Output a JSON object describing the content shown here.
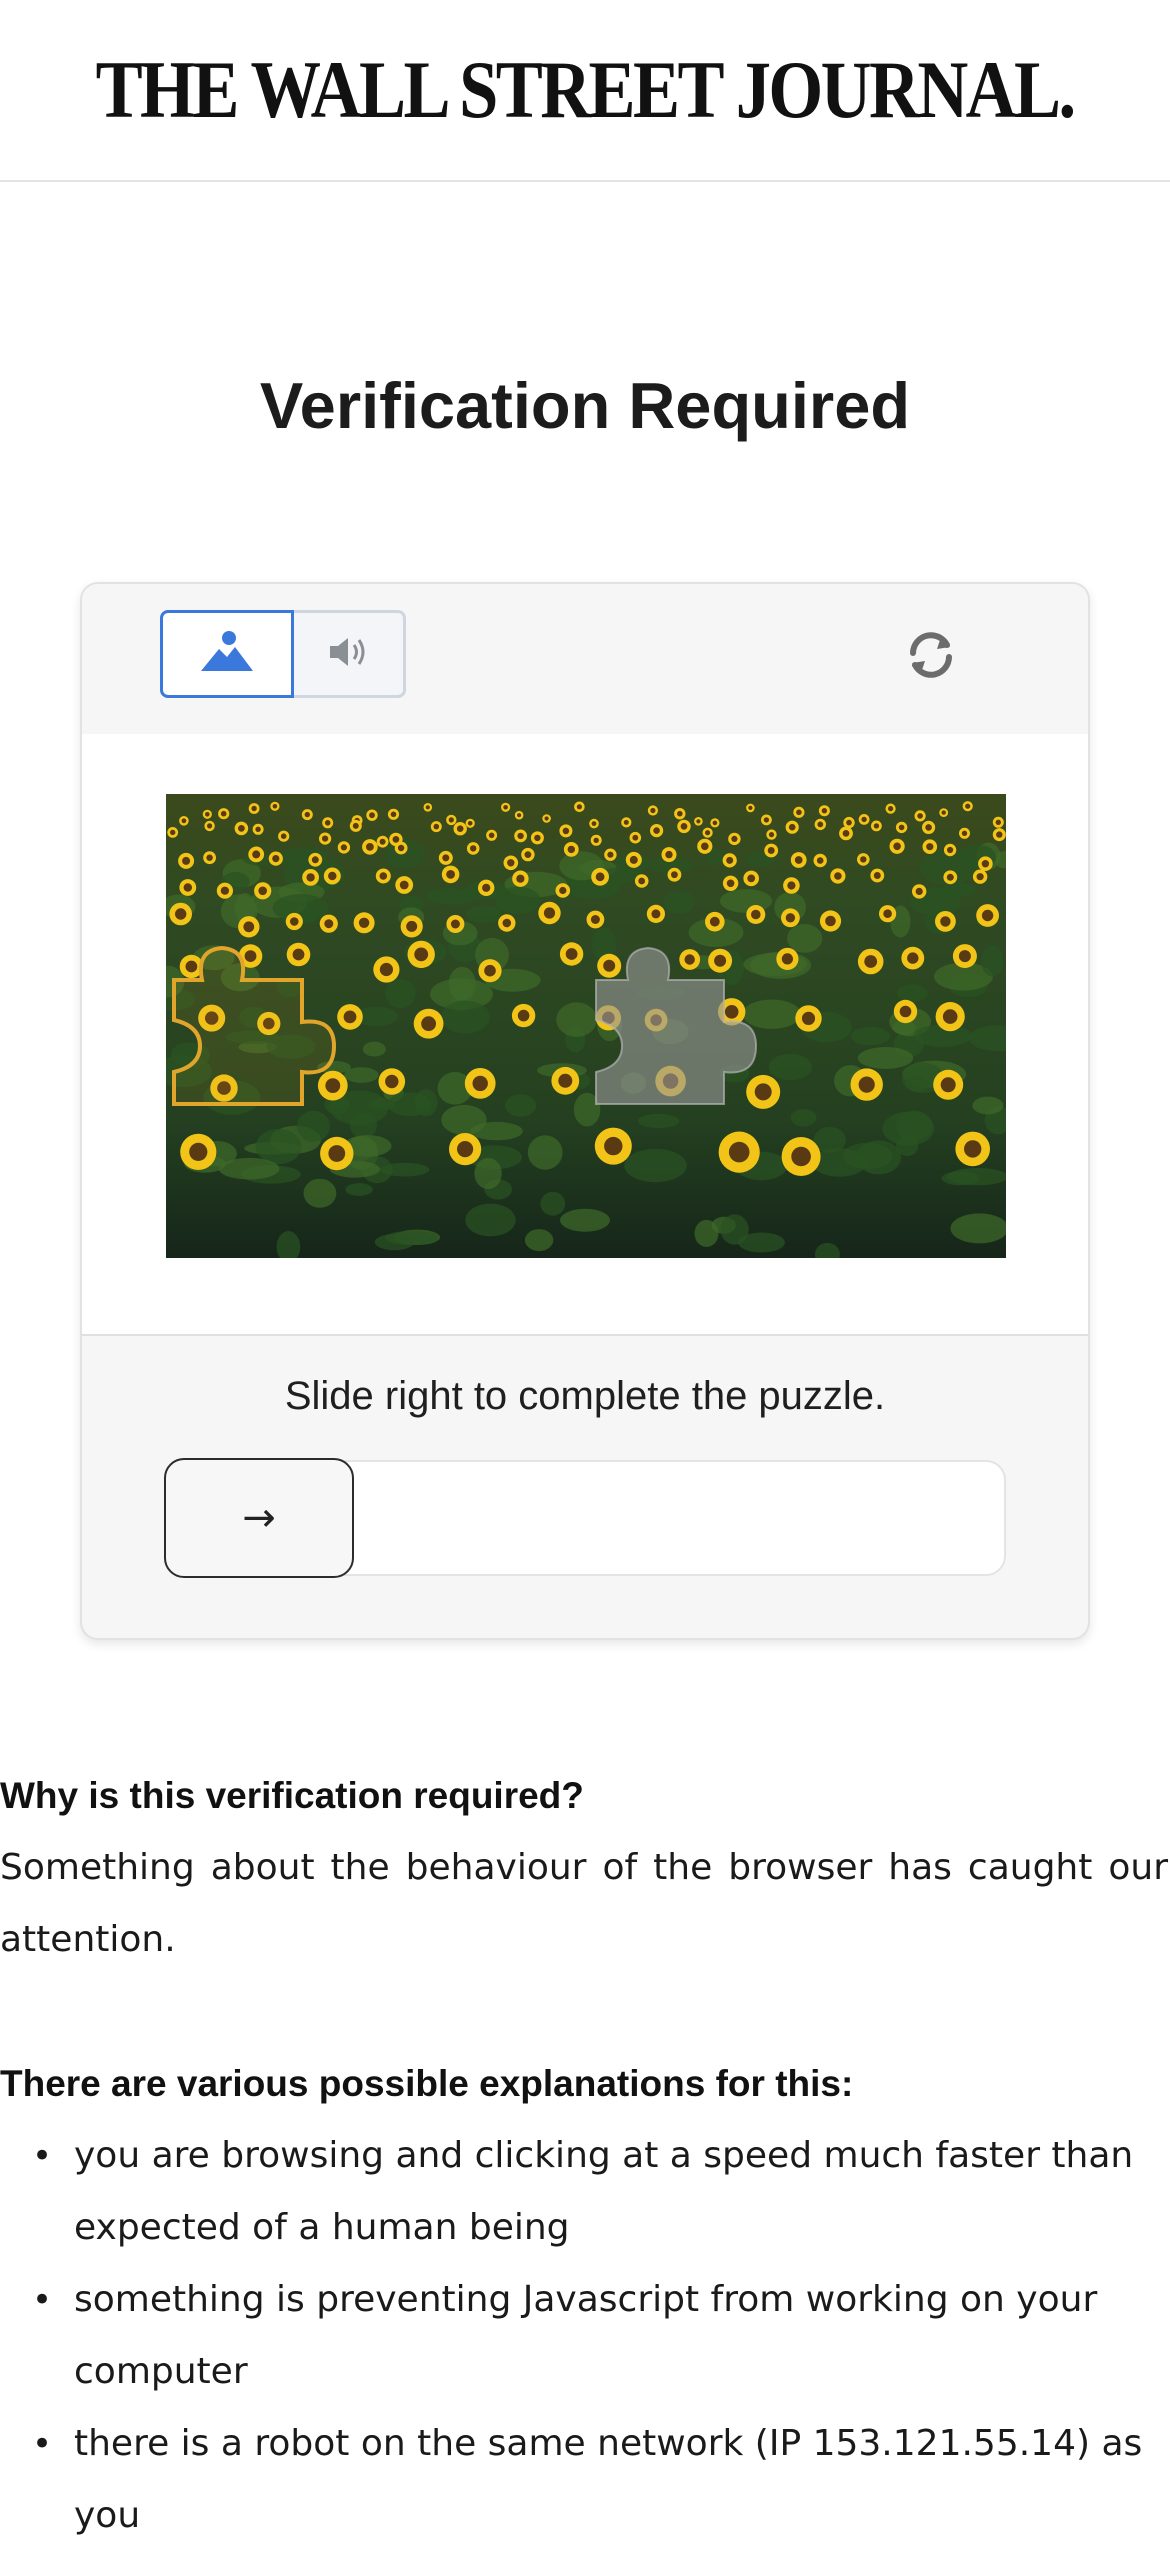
{
  "masthead": {
    "logo_text": "THE WALL STREET JOURNAL."
  },
  "page": {
    "title": "Verification Required"
  },
  "captcha": {
    "mode_image_icon": "image-mountain-icon",
    "mode_audio_icon": "speaker-icon",
    "refresh_icon": "refresh-icon",
    "instruction": "Slide right to complete the puzzle.",
    "slider_arrow": "→",
    "slider_progress": 0,
    "accent_color": "#3b78db"
  },
  "info": {
    "why_heading": "Why is this verification required?",
    "why_text": "Something about the behaviour of the browser has caught our attention.",
    "explanations_heading": "There are various possible explanations for this:",
    "explanations": [
      "you are browsing and clicking at a speed much faster than expected of a human being",
      "something is preventing Javascript from working on your computer",
      "there is a robot on the same network (IP 153.121.55.14) as you"
    ]
  }
}
